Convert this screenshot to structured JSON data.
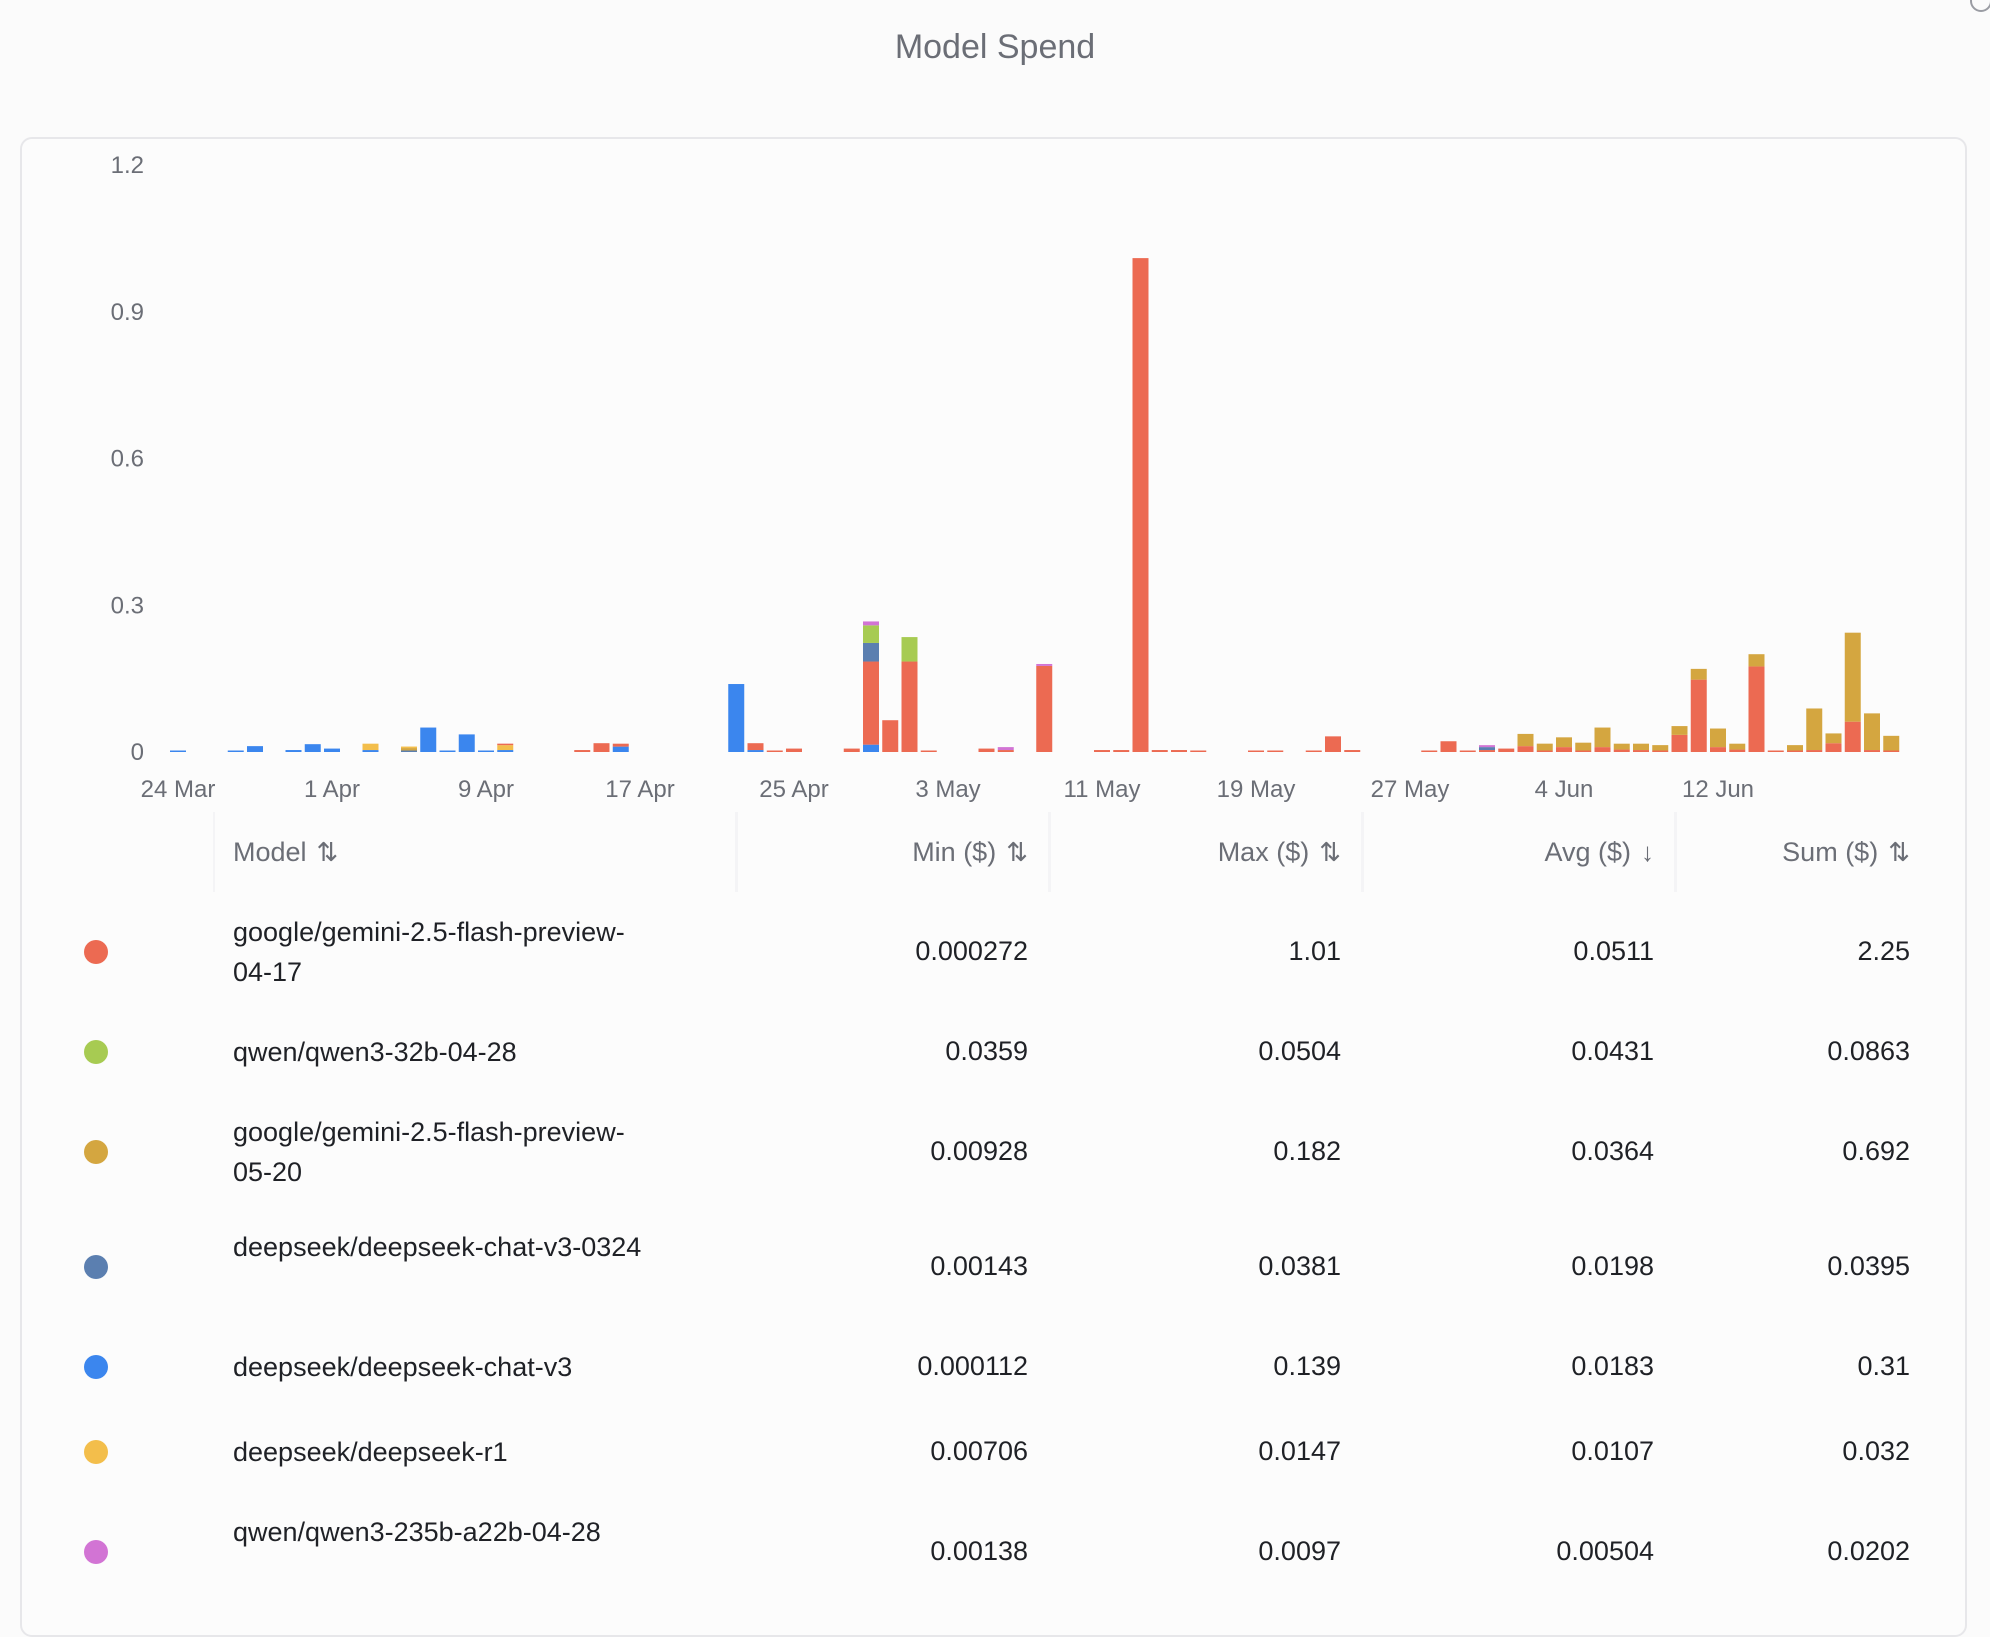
{
  "header": {
    "title": "Model Spend"
  },
  "colors": {
    "gemini_0417": "#ec6a52",
    "qwen32b": "#a7cb52",
    "gemini_0520": "#d4a640",
    "deepseek_v3_0324": "#5b7fb0",
    "deepseek_v3": "#3b86ee",
    "deepseek_r1": "#f3be4b",
    "qwen235b": "#d274d4",
    "grid": "#e8e8ec",
    "axis_text": "#6b6e76"
  },
  "table": {
    "columns": [
      {
        "key": "model",
        "label": "Model",
        "sort": "⇅"
      },
      {
        "key": "min",
        "label": "Min ($)",
        "sort": "⇅"
      },
      {
        "key": "max",
        "label": "Max ($)",
        "sort": "⇅"
      },
      {
        "key": "avg",
        "label": "Avg ($)",
        "sort": "↓"
      },
      {
        "key": "sum",
        "label": "Sum ($)",
        "sort": "⇅"
      }
    ],
    "rows": [
      {
        "model": "google/gemini-2.5-flash-preview-04-17",
        "color": "#ec6a52",
        "min": "0.000272",
        "max": "1.01",
        "avg": "0.0511",
        "sum": "2.25"
      },
      {
        "model": "qwen/qwen3-32b-04-28",
        "color": "#a7cb52",
        "min": "0.0359",
        "max": "0.0504",
        "avg": "0.0431",
        "sum": "0.0863"
      },
      {
        "model": "google/gemini-2.5-flash-preview-05-20",
        "color": "#d4a640",
        "min": "0.00928",
        "max": "0.182",
        "avg": "0.0364",
        "sum": "0.692"
      },
      {
        "model": "deepseek/deepseek-chat-v3-0324",
        "color": "#5b7fb0",
        "min": "0.00143",
        "max": "0.0381",
        "avg": "0.0198",
        "sum": "0.0395"
      },
      {
        "model": "deepseek/deepseek-chat-v3",
        "color": "#3b86ee",
        "min": "0.000112",
        "max": "0.139",
        "avg": "0.0183",
        "sum": "0.31"
      },
      {
        "model": "deepseek/deepseek-r1",
        "color": "#f3be4b",
        "min": "0.00706",
        "max": "0.0147",
        "avg": "0.0107",
        "sum": "0.032"
      },
      {
        "model": "qwen/qwen3-235b-a22b-04-28",
        "color": "#d274d4",
        "min": "0.00138",
        "max": "0.0097",
        "avg": "0.00504",
        "sum": "0.0202"
      }
    ]
  },
  "chart_data": {
    "type": "bar",
    "stacked": true,
    "y_ticks": [
      "0",
      "0.3",
      "0.6",
      "0.9",
      "1.2"
    ],
    "x_tick_labels": [
      "24 Mar",
      "1 Apr",
      "9 Apr",
      "17 Apr",
      "25 Apr",
      "3 May",
      "11 May",
      "19 May",
      "27 May",
      "4 Jun",
      "12 Jun"
    ],
    "ylim": [
      0,
      1.2
    ],
    "grid": false,
    "series": [
      {
        "name": "google/gemini-2.5-flash-preview-04-17",
        "color": "#ec6a52"
      },
      {
        "name": "qwen/qwen3-32b-04-28",
        "color": "#a7cb52"
      },
      {
        "name": "google/gemini-2.5-flash-preview-05-20",
        "color": "#d4a640"
      },
      {
        "name": "deepseek/deepseek-chat-v3-0324",
        "color": "#5b7fb0"
      },
      {
        "name": "deepseek/deepseek-chat-v3",
        "color": "#3b86ee"
      },
      {
        "name": "deepseek/deepseek-r1",
        "color": "#f3be4b"
      },
      {
        "name": "qwen/qwen3-235b-a22b-04-28",
        "color": "#d274d4"
      }
    ],
    "bars": [
      {
        "date": "2025-03-24",
        "stack": [
          [
            4,
            0.002
          ]
        ]
      },
      {
        "date": "2025-03-27",
        "stack": [
          [
            4,
            0.003
          ]
        ]
      },
      {
        "date": "2025-03-28",
        "stack": [
          [
            4,
            0.012
          ]
        ]
      },
      {
        "date": "2025-03-30",
        "stack": [
          [
            4,
            0.004
          ]
        ]
      },
      {
        "date": "2025-03-31",
        "stack": [
          [
            4,
            0.016
          ]
        ]
      },
      {
        "date": "2025-04-01",
        "stack": [
          [
            4,
            0.007
          ]
        ]
      },
      {
        "date": "2025-04-03",
        "stack": [
          [
            4,
            0.004
          ],
          [
            5,
            0.013
          ]
        ]
      },
      {
        "date": "2025-04-05",
        "stack": [
          [
            3,
            0.003
          ],
          [
            2,
            0.005
          ],
          [
            5,
            0.003
          ]
        ]
      },
      {
        "date": "2025-04-06",
        "stack": [
          [
            4,
            0.05
          ]
        ]
      },
      {
        "date": "2025-04-07",
        "stack": [
          [
            4,
            0.003
          ]
        ]
      },
      {
        "date": "2025-04-08",
        "stack": [
          [
            4,
            0.036
          ]
        ]
      },
      {
        "date": "2025-04-09",
        "stack": [
          [
            4,
            0.002
          ]
        ]
      },
      {
        "date": "2025-04-10",
        "stack": [
          [
            4,
            0.004
          ],
          [
            5,
            0.01
          ],
          [
            0,
            0.003
          ]
        ]
      },
      {
        "date": "2025-04-14",
        "stack": [
          [
            0,
            0.004
          ]
        ]
      },
      {
        "date": "2025-04-15",
        "stack": [
          [
            0,
            0.018
          ]
        ]
      },
      {
        "date": "2025-04-16",
        "stack": [
          [
            4,
            0.011
          ],
          [
            0,
            0.006
          ]
        ]
      },
      {
        "date": "2025-04-22",
        "stack": [
          [
            4,
            0.139
          ]
        ]
      },
      {
        "date": "2025-04-23",
        "stack": [
          [
            4,
            0.004
          ],
          [
            0,
            0.014
          ]
        ]
      },
      {
        "date": "2025-04-24",
        "stack": [
          [
            0,
            0.002
          ]
        ]
      },
      {
        "date": "2025-04-25",
        "stack": [
          [
            0,
            0.007
          ]
        ]
      },
      {
        "date": "2025-04-28",
        "stack": [
          [
            0,
            0.007
          ]
        ]
      },
      {
        "date": "2025-04-29",
        "stack": [
          [
            4,
            0.015
          ],
          [
            0,
            0.17
          ],
          [
            3,
            0.038
          ],
          [
            1,
            0.036
          ],
          [
            6,
            0.008
          ]
        ]
      },
      {
        "date": "2025-04-30",
        "stack": [
          [
            0,
            0.065
          ]
        ]
      },
      {
        "date": "2025-05-01",
        "stack": [
          [
            0,
            0.185
          ],
          [
            1,
            0.05
          ]
        ]
      },
      {
        "date": "2025-05-02",
        "stack": [
          [
            0,
            0.002
          ]
        ]
      },
      {
        "date": "2025-05-05",
        "stack": [
          [
            0,
            0.007
          ]
        ]
      },
      {
        "date": "2025-05-06",
        "stack": [
          [
            0,
            0.004
          ],
          [
            6,
            0.006
          ]
        ]
      },
      {
        "date": "2025-05-08",
        "stack": [
          [
            0,
            0.176
          ],
          [
            6,
            0.004
          ]
        ]
      },
      {
        "date": "2025-05-11",
        "stack": [
          [
            0,
            0.004
          ]
        ]
      },
      {
        "date": "2025-05-12",
        "stack": [
          [
            0,
            0.004
          ]
        ]
      },
      {
        "date": "2025-05-13",
        "stack": [
          [
            0,
            1.01
          ]
        ]
      },
      {
        "date": "2025-05-14",
        "stack": [
          [
            0,
            0.004
          ]
        ]
      },
      {
        "date": "2025-05-15",
        "stack": [
          [
            0,
            0.004
          ]
        ]
      },
      {
        "date": "2025-05-16",
        "stack": [
          [
            0,
            0.003
          ]
        ]
      },
      {
        "date": "2025-05-19",
        "stack": [
          [
            0,
            0.002
          ]
        ]
      },
      {
        "date": "2025-05-20",
        "stack": [
          [
            0,
            0.002
          ]
        ]
      },
      {
        "date": "2025-05-22",
        "stack": [
          [
            0,
            0.003
          ]
        ]
      },
      {
        "date": "2025-05-23",
        "stack": [
          [
            0,
            0.032
          ]
        ]
      },
      {
        "date": "2025-05-24",
        "stack": [
          [
            0,
            0.004
          ]
        ]
      },
      {
        "date": "2025-05-28",
        "stack": [
          [
            0,
            0.002
          ]
        ]
      },
      {
        "date": "2025-05-29",
        "stack": [
          [
            0,
            0.022
          ]
        ]
      },
      {
        "date": "2025-05-30",
        "stack": [
          [
            0,
            0.003
          ]
        ]
      },
      {
        "date": "2025-05-31",
        "stack": [
          [
            0,
            0.004
          ],
          [
            3,
            0.006
          ],
          [
            6,
            0.004
          ]
        ]
      },
      {
        "date": "2025-06-01",
        "stack": [
          [
            0,
            0.007
          ]
        ]
      },
      {
        "date": "2025-06-02",
        "stack": [
          [
            0,
            0.012
          ],
          [
            2,
            0.025
          ]
        ]
      },
      {
        "date": "2025-06-03",
        "stack": [
          [
            0,
            0.003
          ],
          [
            2,
            0.014
          ]
        ]
      },
      {
        "date": "2025-06-04",
        "stack": [
          [
            0,
            0.01
          ],
          [
            2,
            0.02
          ]
        ]
      },
      {
        "date": "2025-06-05",
        "stack": [
          [
            0,
            0.003
          ],
          [
            2,
            0.016
          ]
        ]
      },
      {
        "date": "2025-06-06",
        "stack": [
          [
            0,
            0.01
          ],
          [
            2,
            0.04
          ]
        ]
      },
      {
        "date": "2025-06-07",
        "stack": [
          [
            0,
            0.005
          ],
          [
            2,
            0.012
          ]
        ]
      },
      {
        "date": "2025-06-08",
        "stack": [
          [
            0,
            0.004
          ],
          [
            2,
            0.013
          ]
        ]
      },
      {
        "date": "2025-06-09",
        "stack": [
          [
            0,
            0.003
          ],
          [
            2,
            0.011
          ]
        ]
      },
      {
        "date": "2025-06-10",
        "stack": [
          [
            0,
            0.035
          ],
          [
            2,
            0.018
          ]
        ]
      },
      {
        "date": "2025-06-11",
        "stack": [
          [
            0,
            0.148
          ],
          [
            2,
            0.022
          ]
        ]
      },
      {
        "date": "2025-06-12",
        "stack": [
          [
            0,
            0.01
          ],
          [
            2,
            0.038
          ]
        ]
      },
      {
        "date": "2025-06-13",
        "stack": [
          [
            0,
            0.005
          ],
          [
            2,
            0.012
          ]
        ]
      },
      {
        "date": "2025-06-14",
        "stack": [
          [
            0,
            0.175
          ],
          [
            2,
            0.025
          ]
        ]
      },
      {
        "date": "2025-06-15",
        "stack": [
          [
            0,
            0.003
          ]
        ]
      },
      {
        "date": "2025-06-16",
        "stack": [
          [
            0,
            0.003
          ],
          [
            2,
            0.011
          ]
        ]
      },
      {
        "date": "2025-06-17",
        "stack": [
          [
            0,
            0.004
          ],
          [
            2,
            0.085
          ]
        ]
      },
      {
        "date": "2025-06-18",
        "stack": [
          [
            0,
            0.018
          ],
          [
            2,
            0.02
          ]
        ]
      },
      {
        "date": "2025-06-19",
        "stack": [
          [
            0,
            0.062
          ],
          [
            2,
            0.182
          ]
        ]
      },
      {
        "date": "2025-06-20",
        "stack": [
          [
            0,
            0.004
          ],
          [
            2,
            0.075
          ]
        ]
      },
      {
        "date": "2025-06-21",
        "stack": [
          [
            0,
            0.003
          ],
          [
            2,
            0.03
          ]
        ]
      }
    ]
  }
}
